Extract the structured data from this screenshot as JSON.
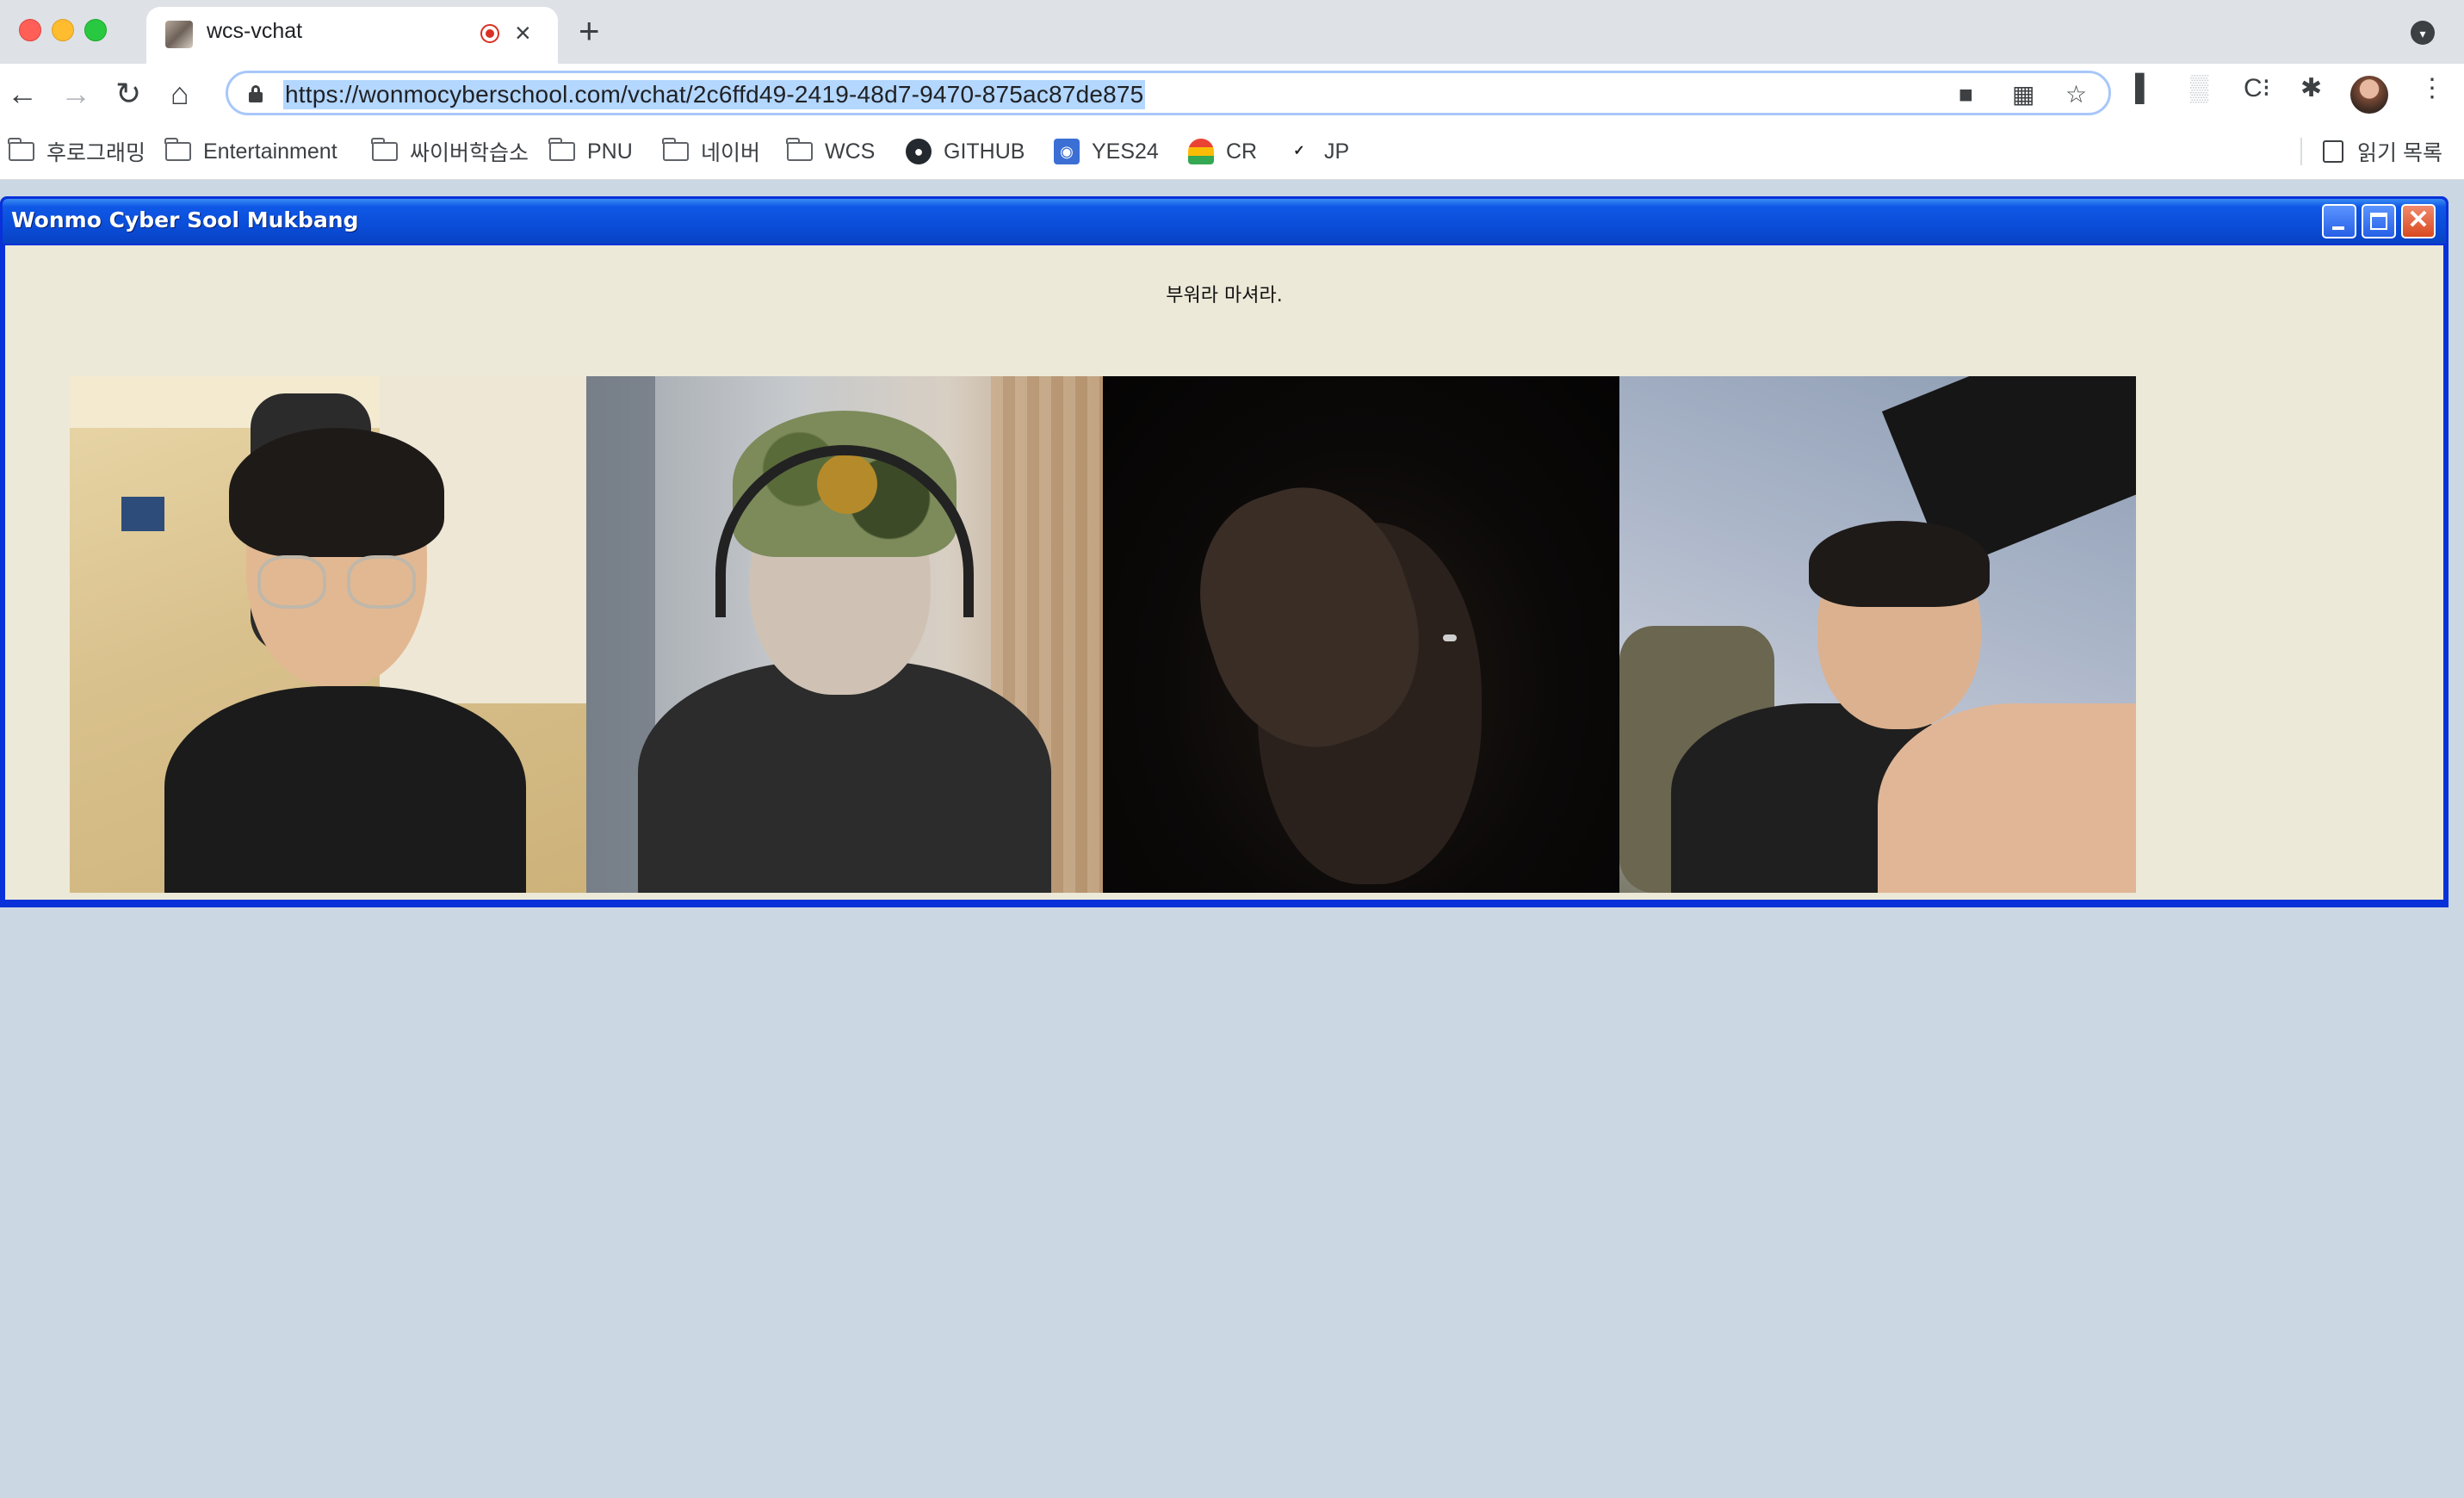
{
  "browser": {
    "tab": {
      "title": "wcs-vchat"
    },
    "address_bar": {
      "url": "https://wonmocyberschool.com/vchat/2c6ffd49-2419-48d7-9470-875ac87de875"
    },
    "nav_glyphs": {
      "back": "←",
      "forward": "→",
      "reload": "↻",
      "home": "⌂",
      "new_tab": "+",
      "close_tab": "×",
      "tab_menu": "▾",
      "more": "⋮"
    },
    "toolbar_glyphs": {
      "camera": "■",
      "install": "▦",
      "star": "☆",
      "ext_1": "▌",
      "ext_2": "▒",
      "ext_3": "C⁝",
      "extensions": "✱"
    },
    "bookmarks": [
      {
        "label": "후로그래밍",
        "icon": "folder-icon"
      },
      {
        "label": "Entertainment",
        "icon": "folder-icon"
      },
      {
        "label": "싸이버학습소",
        "icon": "folder-icon"
      },
      {
        "label": "PNU",
        "icon": "folder-icon"
      },
      {
        "label": "네이버",
        "icon": "folder-icon"
      },
      {
        "label": "WCS",
        "icon": "folder-icon"
      },
      {
        "label": "GITHUB",
        "icon": "github-icon"
      },
      {
        "label": "YES24",
        "icon": "yes24-icon"
      },
      {
        "label": "CR",
        "icon": "cr-icon"
      },
      {
        "label": "JP",
        "icon": "json-icon"
      }
    ],
    "reading_list": {
      "label": "읽기 목록"
    }
  },
  "app": {
    "window_title": "Wonmo Cyber Sool Mukbang",
    "message": "부워라 마셔라.",
    "close_glyph": "✕",
    "video_feeds": [
      {
        "id": "feed-1",
        "scene": "person with glasses, beige room"
      },
      {
        "id": "feed-2",
        "scene": "person with headphones and camo cap"
      },
      {
        "id": "feed-3",
        "scene": "dark room, hand on face"
      },
      {
        "id": "feed-4",
        "scene": "person reclining, poster behind"
      }
    ]
  },
  "colors": {
    "titlebar": "#0a4dd8",
    "client_bg": "#ece9d8",
    "page_bg": "#cbd8e3",
    "url_highlight": "#b3d7ff"
  }
}
